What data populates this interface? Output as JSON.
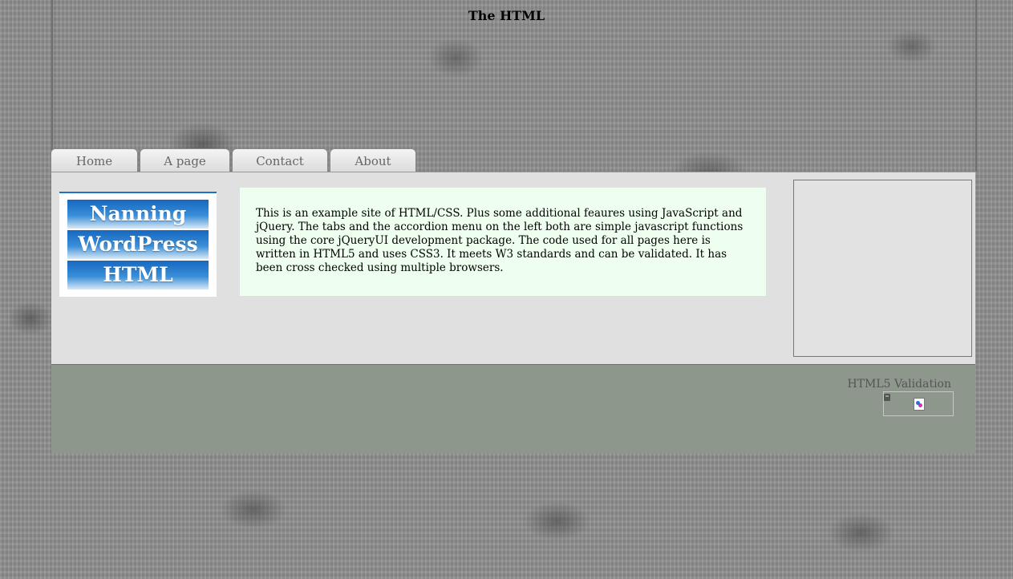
{
  "site": {
    "title": "The HTML"
  },
  "nav": {
    "tabs": [
      {
        "label": "Home"
      },
      {
        "label": "A page"
      },
      {
        "label": "Contact"
      },
      {
        "label": "About"
      }
    ]
  },
  "logo": {
    "lines": [
      "Nanning",
      "WordPress",
      "HTML"
    ]
  },
  "intro": {
    "text": "This is an example site of HTML/CSS. Plus some additional feaures using JavaScript and jQuery. The tabs and the accordion menu on the left both are simple javascript functions using the core jQueryUI development package. The code used for all pages here is written in HTML5 and uses CSS3. It meets W3 standards and can be validated. It has been cross checked using multiple browsers."
  },
  "footer": {
    "validation_label": "HTML5 Validation"
  },
  "colors": {
    "main_bg": "#e0e0e0",
    "intro_bg": "#efffef",
    "footer_bg": "#8e978c",
    "logo_blue": "#1668c0"
  }
}
